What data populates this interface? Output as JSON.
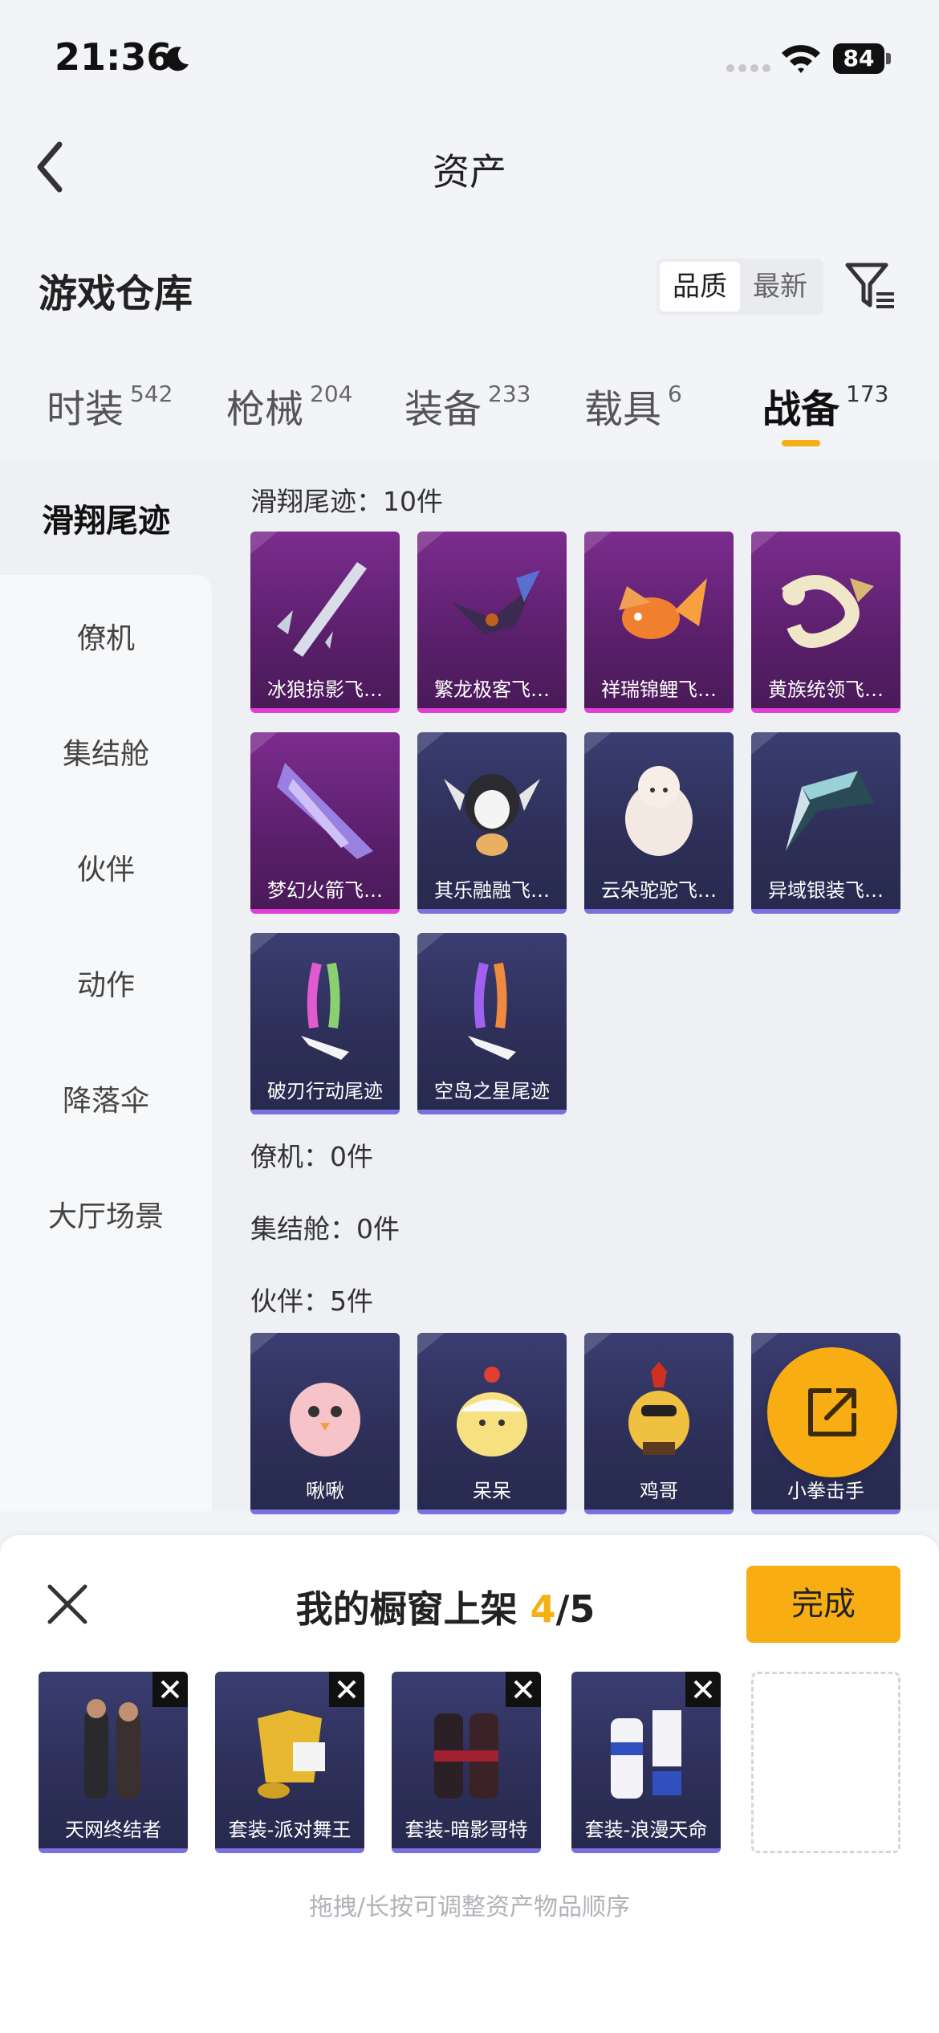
{
  "status_bar": {
    "time": "21:36",
    "battery": "84"
  },
  "nav": {
    "title": "资产"
  },
  "warehouse": {
    "title": "游戏仓库",
    "sort_options": [
      "品质",
      "最新"
    ]
  },
  "tabs": [
    {
      "label": "时装",
      "count": "542"
    },
    {
      "label": "枪械",
      "count": "204"
    },
    {
      "label": "装备",
      "count": "233"
    },
    {
      "label": "载具",
      "count": "6"
    },
    {
      "label": "战备",
      "count": "173"
    }
  ],
  "sidebar": [
    "滑翔尾迹",
    "僚机",
    "集结舱",
    "伙伴",
    "动作",
    "降落伞",
    "大厅场景"
  ],
  "sections": {
    "glide_trail": "滑翔尾迹：10件",
    "wingman": "僚机：0件",
    "assembly_pod": "集结舱：0件",
    "partner": "伙伴：5件"
  },
  "glide_items": [
    {
      "name": "冰狼掠影飞…",
      "rarity": "purple",
      "icon": "ice-wolf-glider-icon"
    },
    {
      "name": "繁龙极客飞…",
      "rarity": "purple",
      "icon": "dragon-glider-icon"
    },
    {
      "name": "祥瑞锦鲤飞…",
      "rarity": "purple",
      "icon": "koi-glider-icon"
    },
    {
      "name": "黄族统领飞…",
      "rarity": "purple",
      "icon": "gold-dragon-glider-icon"
    },
    {
      "name": "梦幻火箭飞…",
      "rarity": "purple",
      "icon": "rocket-glider-icon"
    },
    {
      "name": "其乐融融飞…",
      "rarity": "blue",
      "icon": "penguin-glider-icon"
    },
    {
      "name": "云朵驼驼飞…",
      "rarity": "blue",
      "icon": "alpaca-glider-icon"
    },
    {
      "name": "异域银装飞…",
      "rarity": "blue",
      "icon": "silver-wing-glider-icon"
    },
    {
      "name": "破刃行动尾迹",
      "rarity": "blue",
      "icon": "smoke-trail-icon"
    },
    {
      "name": "空岛之星尾迹",
      "rarity": "blue",
      "icon": "smoke-trail-icon"
    }
  ],
  "partner_items": [
    {
      "name": "啾啾",
      "icon": "pink-bird-icon"
    },
    {
      "name": "呆呆",
      "icon": "chick-icon"
    },
    {
      "name": "鸡哥",
      "icon": "rooster-icon"
    },
    {
      "name": "小拳击手",
      "icon": "boxer-icon"
    }
  ],
  "sheet": {
    "title": "我的橱窗上架",
    "count": "4",
    "total": "/5",
    "done_label": "完成",
    "hint": "拖拽/长按可调整资产物品顺序",
    "items": [
      {
        "name": "天网终结者"
      },
      {
        "name": "套装-派对舞王"
      },
      {
        "name": "套装-暗影哥特"
      },
      {
        "name": "套装-浪漫天命"
      }
    ]
  },
  "colors": {
    "accent": "#f8ad12",
    "purple_rarity": "#e040d8",
    "blue_rarity": "#7a70e0"
  }
}
